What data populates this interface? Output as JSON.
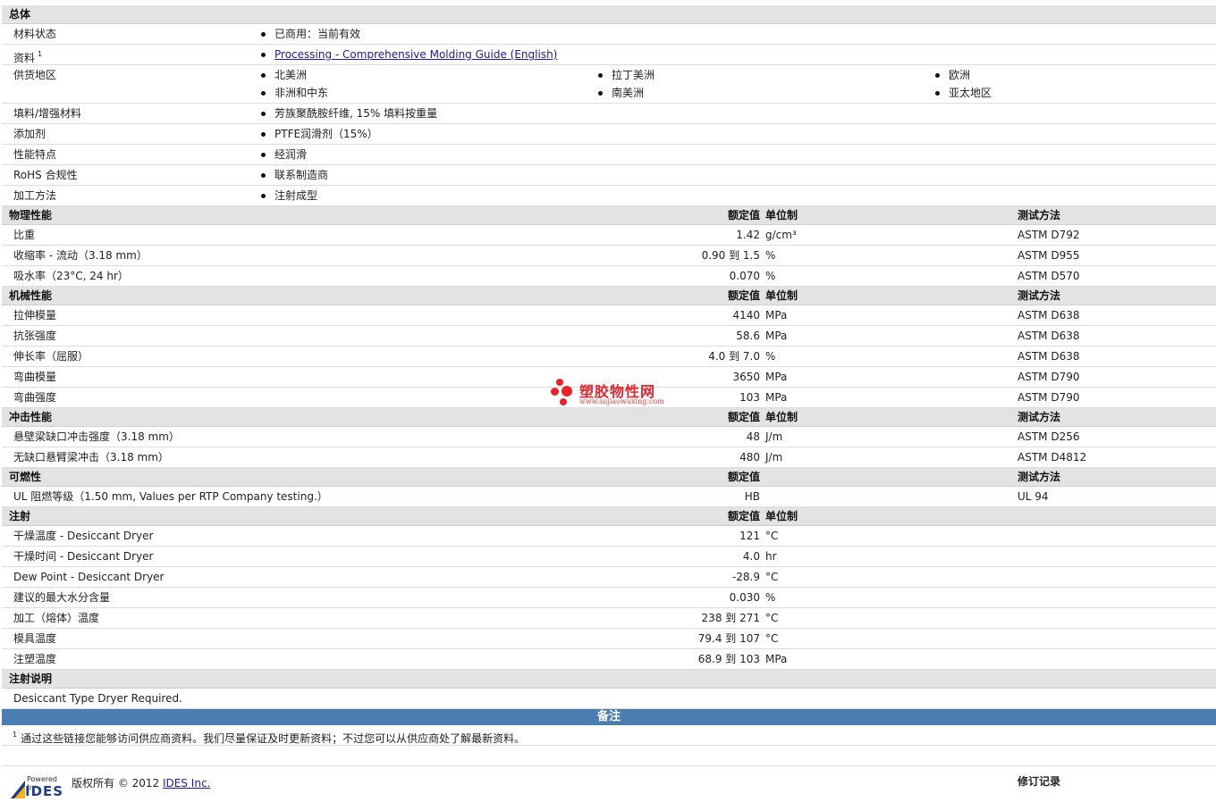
{
  "sections": {
    "general": {
      "title": "总体",
      "material_status": {
        "label": "材料状态",
        "value": "已商用：当前有效"
      },
      "literature": {
        "label": "资料",
        "sup": "1",
        "link": "Processing - Comprehensive Molding Guide (English)"
      },
      "availability": {
        "label": "供货地区",
        "values": [
          "北美洲",
          "拉丁美洲",
          "欧洲",
          "非洲和中东",
          "南美洲",
          "亚太地区"
        ]
      },
      "filler": {
        "label": "填料/增强材料",
        "value": "芳族聚酰胺纤维, 15% 填料按重量"
      },
      "additive": {
        "label": "添加剂",
        "value": "PTFE润滑剂（15%）"
      },
      "features": {
        "label": "性能特点",
        "value": "经润滑"
      },
      "rohs": {
        "label": "RoHS 合规性",
        "value": "联系制造商"
      },
      "processing": {
        "label": "加工方法",
        "value": "注射成型"
      }
    },
    "physical": {
      "title": "物理性能",
      "h_nominal": "额定值",
      "h_unit": "单位制",
      "h_method": "测试方法",
      "rows": [
        {
          "label": "比重",
          "value": "1.42",
          "unit": "g/cm³",
          "method": "ASTM D792"
        },
        {
          "label": "收缩率 - 流动（3.18 mm）",
          "value": "0.90 到  1.5",
          "unit": "%",
          "method": "ASTM D955"
        },
        {
          "label": "吸水率（23°C, 24 hr）",
          "value": "0.070",
          "unit": "%",
          "method": "ASTM D570"
        }
      ]
    },
    "mechanical": {
      "title": "机械性能",
      "h_nominal": "额定值",
      "h_unit": "单位制",
      "h_method": "测试方法",
      "rows": [
        {
          "label": "拉伸模量",
          "value": "4140",
          "unit": "MPa",
          "method": "ASTM D638"
        },
        {
          "label": "抗张强度",
          "value": "58.6",
          "unit": "MPa",
          "method": "ASTM D638"
        },
        {
          "label": "伸长率（屈服）",
          "value": "4.0 到  7.0",
          "unit": "%",
          "method": "ASTM D638"
        },
        {
          "label": "弯曲模量",
          "value": "3650",
          "unit": "MPa",
          "method": "ASTM D790"
        },
        {
          "label": "弯曲强度",
          "value": "103",
          "unit": "MPa",
          "method": "ASTM D790"
        }
      ]
    },
    "impact": {
      "title": "冲击性能",
      "h_nominal": "额定值",
      "h_unit": "单位制",
      "h_method": "测试方法",
      "rows": [
        {
          "label": "悬壁梁缺口冲击强度（3.18 mm）",
          "value": "48",
          "unit": "J/m",
          "method": "ASTM D256"
        },
        {
          "label": "无缺口悬臂梁冲击（3.18 mm）",
          "value": "480",
          "unit": "J/m",
          "method": "ASTM D4812"
        }
      ]
    },
    "flammability": {
      "title": "可燃性",
      "h_nominal": "额定值",
      "h_method": "测试方法",
      "rows": [
        {
          "label": "UL 阻燃等级（1.50 mm, Values per RTP Company testing.）",
          "value": "HB",
          "unit": "",
          "method": "UL 94"
        }
      ]
    },
    "injection": {
      "title": "注射",
      "h_nominal": "额定值",
      "h_unit": "单位制",
      "rows": [
        {
          "label": "干燥温度 - Desiccant Dryer",
          "value": "121",
          "unit": "°C"
        },
        {
          "label": "干燥时间 - Desiccant Dryer",
          "value": "4.0",
          "unit": "hr"
        },
        {
          "label": "Dew Point - Desiccant Dryer",
          "value": "-28.9",
          "unit": "°C"
        },
        {
          "label": "建议的最大水分含量",
          "value": "0.030",
          "unit": "%"
        },
        {
          "label": "加工（熔体）温度",
          "value": "238 到  271",
          "unit": "°C"
        },
        {
          "label": "模具温度",
          "value": "79.4 到  107",
          "unit": "°C"
        },
        {
          "label": "注塑温度",
          "value": "68.9 到  103",
          "unit": "MPa"
        }
      ]
    },
    "injection_notes": {
      "title": "注射说明",
      "text": "Desiccant Type Dryer Required."
    }
  },
  "notes": {
    "title": "备注",
    "footnote_num": "1",
    "footnote": "通过这些链接您能够访问供应商资料。我们尽量保证及时更新资料；不过您可以从供应商处了解最新资料。"
  },
  "footer": {
    "powered_by": "Powered by",
    "logo": "IDES",
    "copyright": "版权所有 © 2012",
    "company_link": "IDES Inc.",
    "revision_title": "修订记录"
  },
  "watermark": {
    "text": "塑胶物性网",
    "url": "www.sujiaowuxing.com"
  },
  "colors": {
    "section_bg": "#e3e3e3",
    "notes_bar": "#4a7eb0",
    "link": "#1a1aa6",
    "watermark": "#e8232a"
  }
}
